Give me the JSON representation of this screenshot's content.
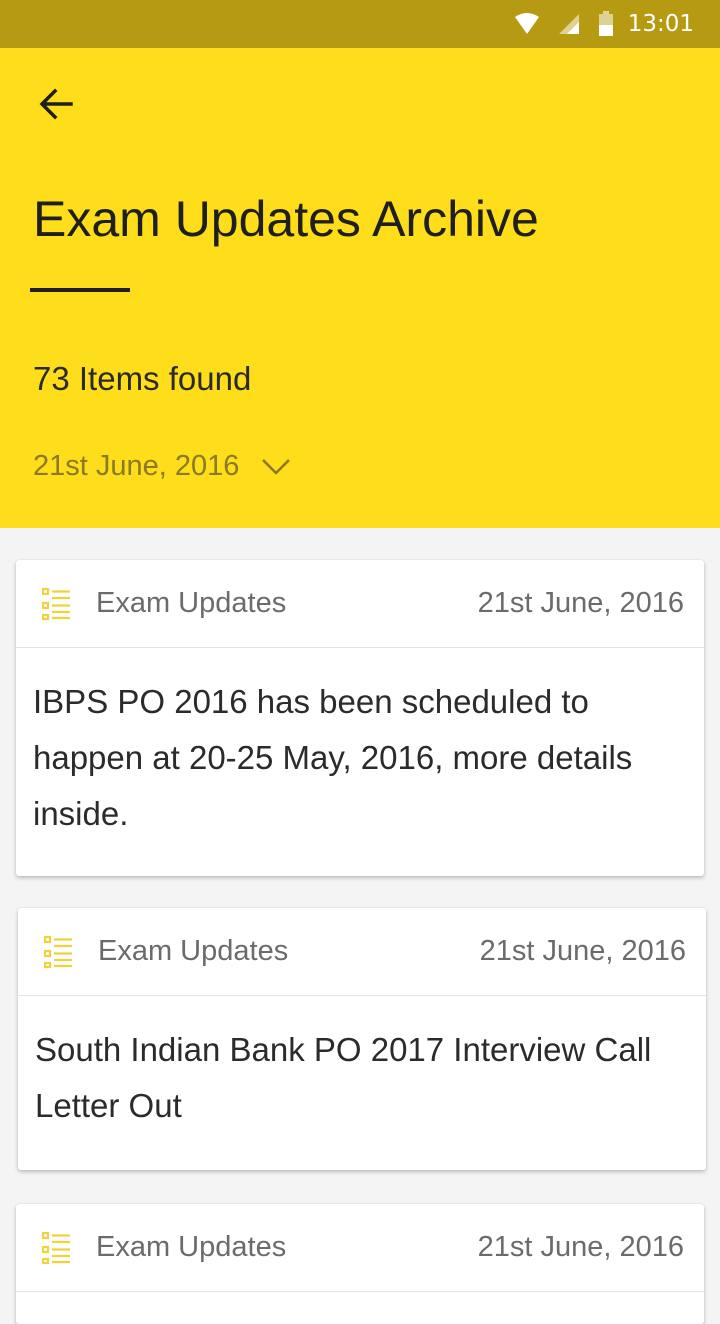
{
  "status_bar": {
    "time": "13:01",
    "icons": [
      "wifi-icon",
      "signal-icon",
      "battery-icon"
    ]
  },
  "header": {
    "back_icon": "arrow-left-icon",
    "title": "Exam Updates Archive",
    "items_found": "73 Items found",
    "date_filter": "21st June, 2016",
    "date_filter_icon": "chevron-down-icon"
  },
  "colors": {
    "status_bar": "#b59a12",
    "header_bg": "#fedd1a",
    "list_icon": "#f2d23a"
  },
  "cards": [
    {
      "icon": "list-icon",
      "category": "Exam Updates",
      "date": "21st June, 2016",
      "text": "IBPS PO 2016 has been scheduled to happen at 20-25 May, 2016, more details inside."
    },
    {
      "icon": "list-icon",
      "category": "Exam Updates",
      "date": "21st June, 2016",
      "text": "South Indian Bank PO 2017 Interview Call Letter Out"
    },
    {
      "icon": "list-icon",
      "category": "Exam Updates",
      "date": "21st June, 2016",
      "text": ""
    }
  ]
}
